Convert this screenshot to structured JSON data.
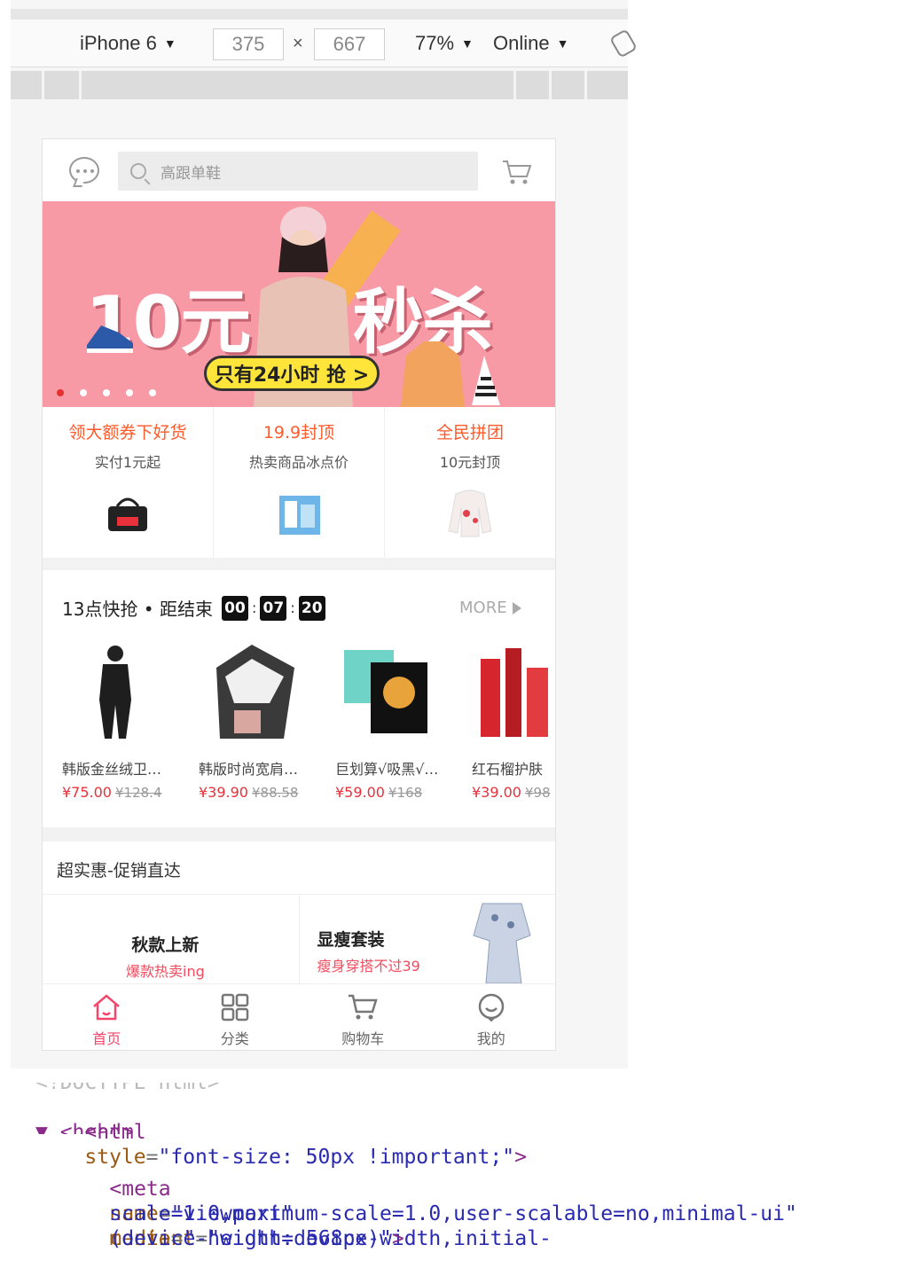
{
  "devtools": {
    "device": "iPhone 6",
    "width": "375",
    "times": "×",
    "height": "667",
    "zoom": "77%",
    "network": "Online"
  },
  "header": {
    "search_placeholder": "高跟单鞋"
  },
  "banner": {
    "big_left": "10元",
    "big_right": "秒杀",
    "pill": "只有24小时 抢 >"
  },
  "promos": [
    {
      "title": "领大额券下好货",
      "sub": "实付1元起"
    },
    {
      "title": "19.9封顶",
      "sub": "热卖商品冰点价"
    },
    {
      "title": "全民拼团",
      "sub": "10元封顶"
    }
  ],
  "flash": {
    "title": "13点快抢 • 距结束",
    "hours": "00",
    "minutes": "07",
    "seconds": "20",
    "colon": ":",
    "more": "MORE",
    "goods": [
      {
        "name": "韩版金丝绒卫…",
        "price": "¥75.00",
        "old": "¥128.4"
      },
      {
        "name": "韩版时尚宽肩…",
        "price": "¥39.90",
        "old": "¥88.58"
      },
      {
        "name": "巨划算√吸黑√…",
        "price": "¥59.00",
        "old": "¥168"
      },
      {
        "name": "红石榴护肤",
        "price": "¥39.00",
        "old": "¥98"
      }
    ]
  },
  "deals": {
    "title": "超实惠-促销直达",
    "items": [
      {
        "name": "秋款上新",
        "sub": "爆款热卖ing"
      },
      {
        "name": "显瘦套装",
        "sub": "瘦身穿搭不过39"
      }
    ]
  },
  "tabbar": [
    {
      "label": "首页"
    },
    {
      "label": "分类"
    },
    {
      "label": "购物车"
    },
    {
      "label": "我的"
    }
  ],
  "code": {
    "line0": "<!DOCTYPE html>",
    "html_tag": "<html",
    "style_attr": "style",
    "style_val": "\"font-size: 50px !important;\"",
    "html_close": ">",
    "head": "▼ <head>",
    "meta_tag": "<meta",
    "name_attr": "name",
    "name_val": "\"viewport\"",
    "content_attr": "content",
    "content_val1": "\"width=device-width,initial-",
    "content_val2": "scale=1.0,maximum-scale=1.0,user-scalable=no,minimal-ui\"",
    "media_attr": "media",
    "media_val1": "\"",
    "media_val2": "(device-height: 568px)\"",
    "meta_close": ">"
  },
  "colors": {
    "accent_orange": "#ff5a2a",
    "price_red": "#e8313a",
    "tab_active": "#f4466a",
    "banner_pink": "#f79aa6"
  }
}
